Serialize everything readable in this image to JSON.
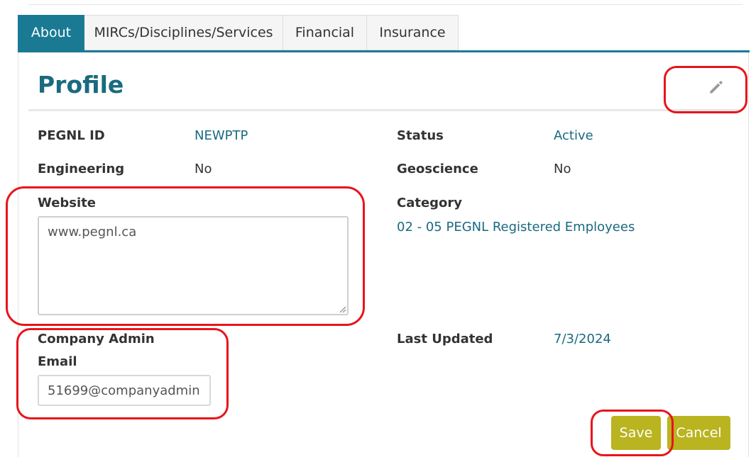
{
  "tabs": [
    {
      "label": "About",
      "active": true
    },
    {
      "label": "MIRCs/Disciplines/Services",
      "active": false
    },
    {
      "label": "Financial",
      "active": false
    },
    {
      "label": "Insurance",
      "active": false
    }
  ],
  "profile": {
    "title": "Profile",
    "fields": {
      "pegnl_id": {
        "label": "PEGNL ID",
        "value": "NEWPTP"
      },
      "status": {
        "label": "Status",
        "value": "Active"
      },
      "engineering": {
        "label": "Engineering",
        "value": "No"
      },
      "geoscience": {
        "label": "Geoscience",
        "value": "No"
      },
      "website": {
        "label": "Website",
        "value": "www.pegnl.ca"
      },
      "category": {
        "label": "Category",
        "value": "02 - 05 PEGNL Registered Employees"
      },
      "company_admin_email": {
        "label_line1": "Company Admin",
        "label_line2": "Email",
        "value": "51699@companyadmin"
      },
      "last_updated": {
        "label": "Last Updated",
        "value": "7/3/2024"
      }
    }
  },
  "actions": {
    "save_label": "Save",
    "cancel_label": "Cancel"
  },
  "icons": {
    "edit": "pencil-icon"
  },
  "colors": {
    "accent": "#1a7a93",
    "button": "#b9b41f",
    "annotation": "#e8141b"
  }
}
